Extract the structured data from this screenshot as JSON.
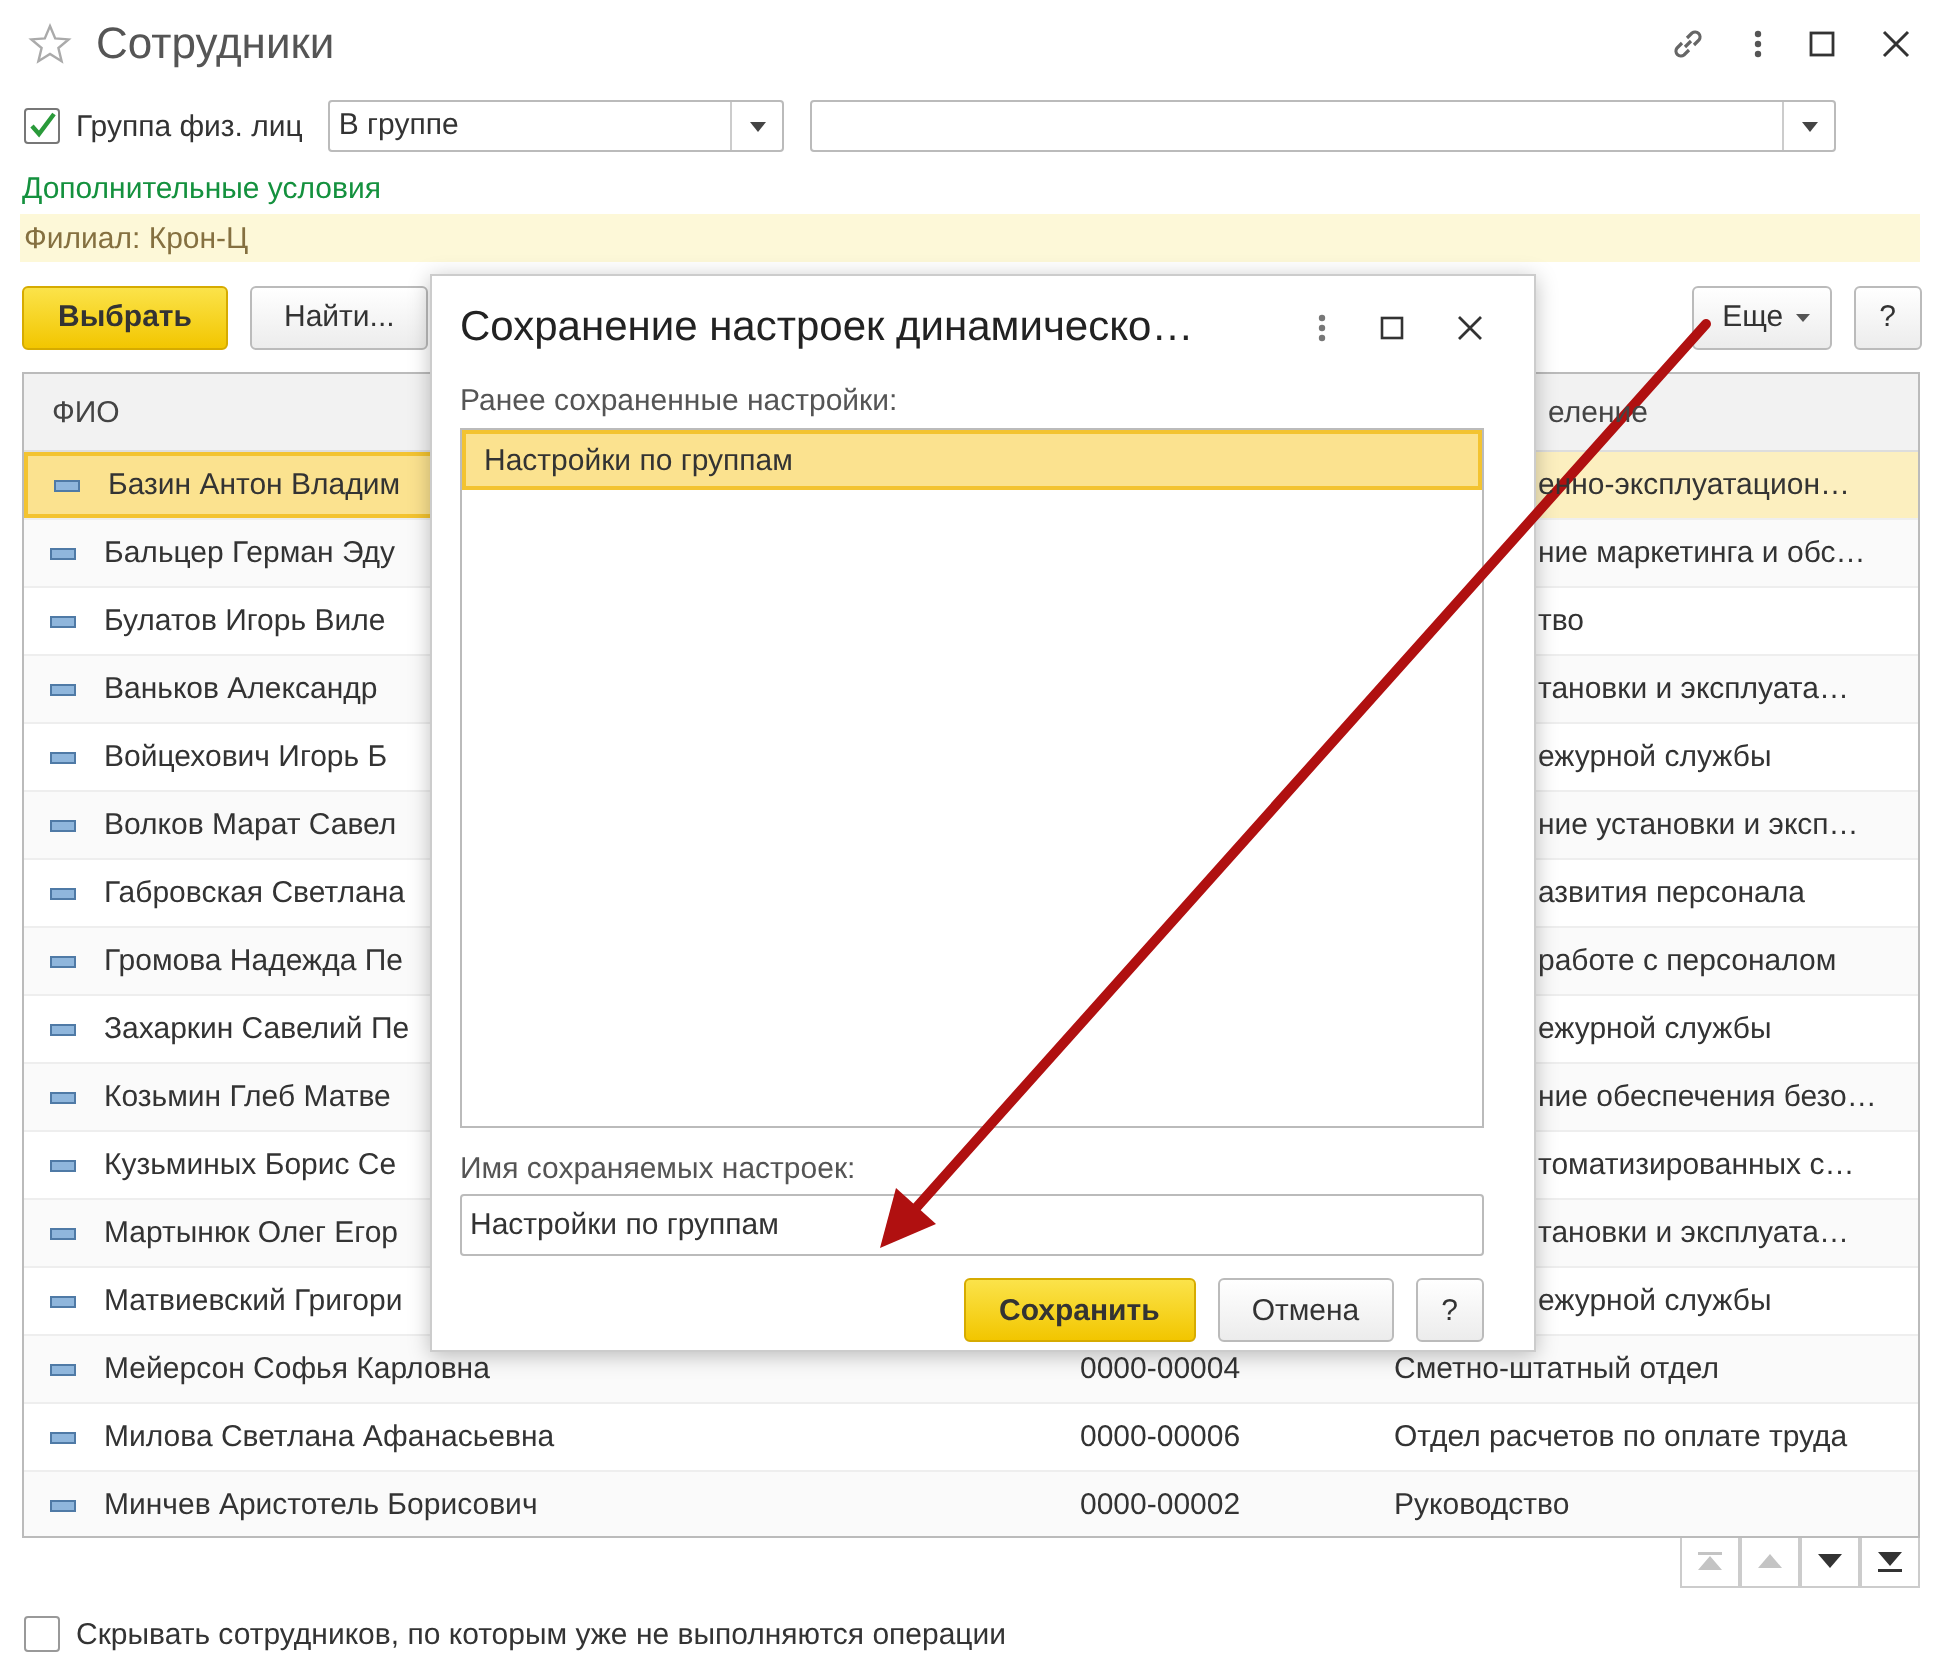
{
  "window": {
    "title": "Сотрудники"
  },
  "filter": {
    "checkbox": {
      "label": "Группа физ. лиц",
      "checked": true
    },
    "condition": "В группе"
  },
  "extra_conditions_link": "Дополнительные условия",
  "applied_filter": "Филиал: Крон-Ц",
  "toolbar": {
    "select_button": "Выбрать",
    "find_button": "Найти...",
    "more_button": "Еще",
    "help_button": "?"
  },
  "table": {
    "columns": {
      "column_1": "ФИО",
      "column_3": "еление"
    },
    "rows": [
      {
        "kind": "partly_hidden",
        "name": "Базин Антон Владим",
        "department": "енно-эксплуатацион…",
        "selected": true
      },
      {
        "kind": "partly_hidden",
        "name": "Бальцер Герман Эду",
        "department": "ние маркетинга и обс…",
        "selected": false
      },
      {
        "kind": "partly_hidden",
        "name": "Булатов Игорь Виле",
        "department": "тво",
        "selected": false
      },
      {
        "kind": "partly_hidden",
        "name": "Ваньков Александр",
        "department": "тановки и эксплуата…",
        "selected": false
      },
      {
        "kind": "partly_hidden",
        "name": "Войцехович Игорь Б",
        "department": "ежурной службы",
        "selected": false
      },
      {
        "kind": "partly_hidden",
        "name": "Волков Марат Савел",
        "department": "ние установки и эксп…",
        "selected": false
      },
      {
        "kind": "partly_hidden",
        "name": "Габровская Светлана",
        "department": "азвития персонала",
        "selected": false
      },
      {
        "kind": "partly_hidden",
        "name": "Громова Надежда Пе",
        "department": "работе с персоналом",
        "selected": false
      },
      {
        "kind": "partly_hidden",
        "name": "Захаркин Савелий Пе",
        "department": "ежурной службы",
        "selected": false
      },
      {
        "kind": "partly_hidden",
        "name": "Козьмин Глеб Матве",
        "department": "ние обеспечения безо…",
        "selected": false
      },
      {
        "kind": "partly_hidden",
        "name": "Кузьминых Борис Се",
        "department": "томатизированных с…",
        "selected": false
      },
      {
        "kind": "partly_hidden",
        "name": "Мартынюк Олег Егор",
        "department": "тановки и эксплуата…",
        "selected": false
      },
      {
        "kind": "partly_hidden",
        "name": "Матвиевский Григори",
        "department": "ежурной службы",
        "selected": false
      },
      {
        "kind": "full",
        "name": "Мейерсон Софья Карловна",
        "code": "0000-00004",
        "department": "Сметно-штатный отдел",
        "selected": false
      },
      {
        "kind": "full",
        "name": "Милова Светлана Афанасьевна",
        "code": "0000-00006",
        "department": "Отдел расчетов по оплате труда",
        "selected": false
      },
      {
        "kind": "full",
        "name": "Минчев Аристотель Борисович",
        "code": "0000-00002",
        "department": "Руководство",
        "selected": false
      }
    ],
    "nav_buttons": [
      {
        "kind": "first",
        "disabled": true
      },
      {
        "kind": "up",
        "disabled": true
      },
      {
        "kind": "down",
        "disabled": false
      },
      {
        "kind": "last",
        "disabled": false
      }
    ]
  },
  "footer_checkbox": {
    "label": "Скрывать сотрудников, по которым уже не выполняются операции",
    "checked": false
  },
  "dialog": {
    "title": "Сохранение настроек динамическо…",
    "list_label": "Ранее сохраненные настройки:",
    "saved": [
      {
        "label": "Настройки по группам",
        "selected": true
      }
    ],
    "name_label": "Имя сохраняемых настроек:",
    "name_value": "Настройки по группам",
    "buttons": [
      {
        "label": "Сохранить",
        "kind": "primary"
      },
      {
        "label": "Отмена",
        "kind": "normal"
      },
      {
        "label": "?",
        "kind": "help"
      }
    ]
  }
}
